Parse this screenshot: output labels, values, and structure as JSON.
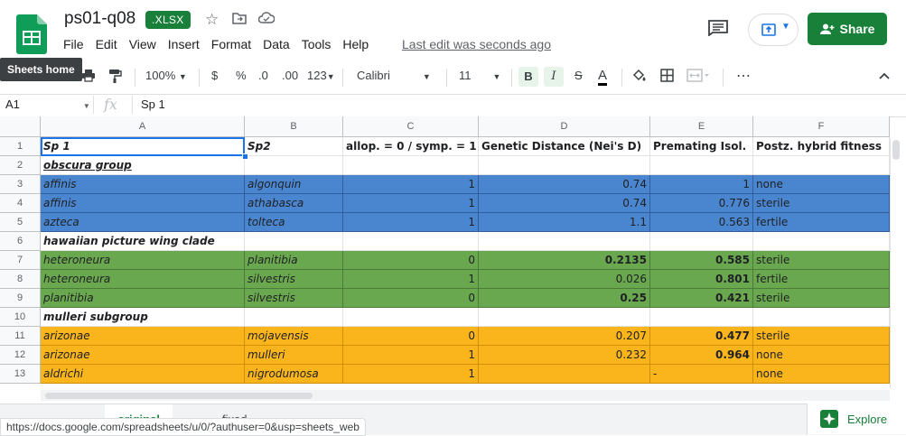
{
  "doc": {
    "title": "ps01-q08",
    "format_badge": ".XLSX",
    "last_edit": "Last edit was seconds ago"
  },
  "menu": [
    "File",
    "Edit",
    "View",
    "Insert",
    "Format",
    "Data",
    "Tools",
    "Help"
  ],
  "header": {
    "share_label": "Share",
    "tooltip": "Sheets home"
  },
  "toolbar": {
    "zoom": "100%",
    "currency": "$",
    "percent": "%",
    "dec_less": ".0",
    "dec_more": ".00",
    "number_format": "123",
    "font": "Calibri",
    "font_size": "11",
    "bold": "B",
    "italic": "I",
    "strike": "S",
    "text_color": "A",
    "more": "⋯"
  },
  "formula_bar": {
    "name_box": "A1",
    "fx": "fx",
    "value": "Sp 1"
  },
  "columns": [
    "A",
    "B",
    "C",
    "D",
    "E",
    "F"
  ],
  "rows": [
    {
      "n": "1",
      "style": "header",
      "cells": [
        "Sp 1",
        "Sp2",
        "allop. = 0 / symp. = 1",
        "Genetic Distance (Nei's D)",
        "Premating Isol.",
        "Postz. hybrid fitness"
      ]
    },
    {
      "n": "2",
      "style": "group",
      "cells": [
        "obscura group",
        "",
        "",
        "",
        "",
        ""
      ]
    },
    {
      "n": "3",
      "style": "blue",
      "cells": [
        "affinis",
        "algonquin",
        "1",
        "0.74",
        "1",
        "none"
      ]
    },
    {
      "n": "4",
      "style": "blue",
      "cells": [
        "affinis",
        "athabasca",
        "1",
        "0.74",
        "0.776",
        "sterile"
      ]
    },
    {
      "n": "5",
      "style": "blue",
      "cells": [
        "azteca",
        "tolteca",
        "1",
        "1.1",
        "0.563",
        "fertile"
      ]
    },
    {
      "n": "6",
      "style": "group2",
      "cells": [
        "hawaiian picture wing clade",
        "",
        "",
        "",
        "",
        ""
      ]
    },
    {
      "n": "7",
      "style": "green",
      "cells": [
        "heteroneura",
        "planitibia",
        "0",
        "0.2135",
        "0.585",
        "sterile"
      ],
      "bold": [
        3,
        4
      ]
    },
    {
      "n": "8",
      "style": "green",
      "cells": [
        "heteroneura",
        "silvestris",
        "1",
        "0.026",
        "0.801",
        "fertile"
      ],
      "bold": [
        4
      ]
    },
    {
      "n": "9",
      "style": "green",
      "cells": [
        "planitibia",
        "silvestris",
        "0",
        "0.25",
        "0.421",
        "sterile"
      ],
      "bold": [
        3,
        4
      ]
    },
    {
      "n": "10",
      "style": "group2",
      "cells": [
        "mulleri subgroup",
        "",
        "",
        "",
        "",
        ""
      ]
    },
    {
      "n": "11",
      "style": "orange",
      "cells": [
        "arizonae",
        "mojavensis",
        "0",
        "0.207",
        "0.477",
        "sterile"
      ],
      "bold": [
        4
      ]
    },
    {
      "n": "12",
      "style": "orange",
      "cells": [
        "arizonae",
        "mulleri",
        "1",
        "0.232",
        "0.964",
        "none"
      ],
      "bold": [
        4
      ]
    },
    {
      "n": "13",
      "style": "orange",
      "cells": [
        "aldrichi",
        "nigrodumosa",
        "1",
        "",
        "-",
        "none"
      ],
      "leftE": true
    }
  ],
  "sheets": [
    "original",
    "fixed"
  ],
  "explore_label": "Explore",
  "status_url": "https://docs.google.com/spreadsheets/u/0/?authuser=0&usp=sheets_web"
}
